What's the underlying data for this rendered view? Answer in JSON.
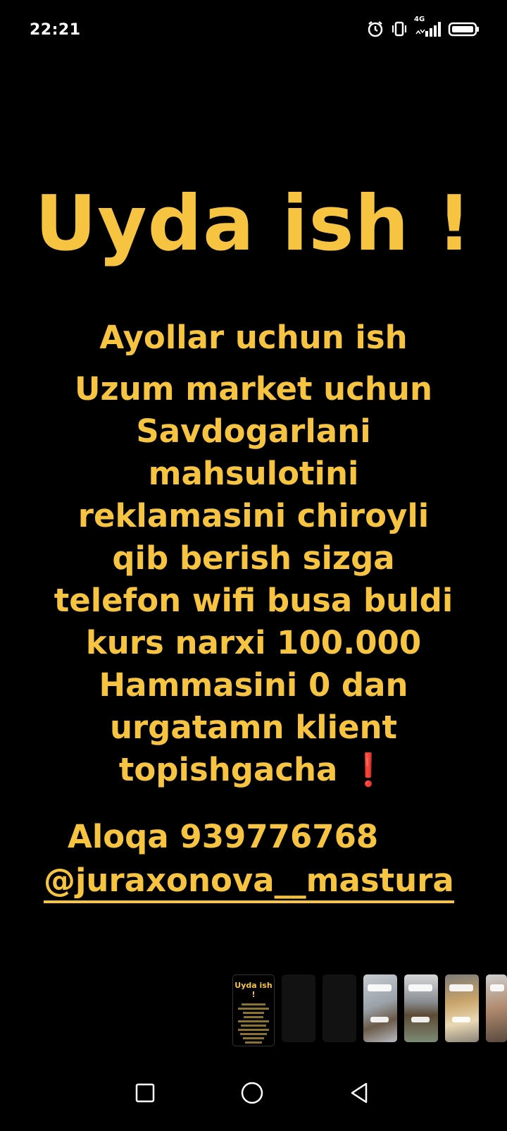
{
  "status_bar": {
    "time": "22:21",
    "network": "4G",
    "icons": [
      "alarm-icon",
      "vibrate-icon",
      "signal-icon",
      "battery-icon"
    ]
  },
  "story": {
    "headline": "Uyda ish !",
    "subheading": "Ayollar uchun ish",
    "lines": [
      "Uzum market uchun",
      "Savdogarlani",
      "mahsulotini",
      "reklamasini chiroyli",
      "qib berish sizga",
      "telefon wifi busa buldi",
      "kurs narxi 100.000",
      "Hammasini 0 dan",
      "urgatamn klient",
      "topishgacha"
    ],
    "exclamation": "❗",
    "contact": "Aloqa 939776768",
    "handle": "@juraxonova__mastura"
  },
  "thumbnail_preview": {
    "title": "Uyda ish !"
  },
  "colors": {
    "accent": "#F6C441",
    "background": "#000000",
    "exclamation": "#E5262B"
  },
  "nav_bar": {
    "icons": [
      "recents-square-icon",
      "home-circle-icon",
      "back-triangle-icon"
    ]
  }
}
